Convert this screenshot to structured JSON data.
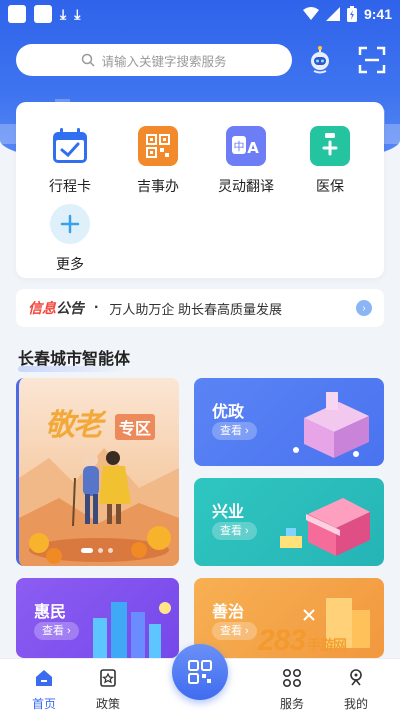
{
  "status_bar": {
    "time": "9:41"
  },
  "search": {
    "placeholder": "请输入关键字搜索服务"
  },
  "services": [
    {
      "label": "行程卡",
      "icon": "calendar-check-icon",
      "color": "#2f6ff0"
    },
    {
      "label": "吉事办",
      "icon": "qrcode-icon",
      "color": "#f28a2c"
    },
    {
      "label": "灵动翻译",
      "icon": "translate-icon",
      "color": "#6c7df5"
    },
    {
      "label": "医保",
      "icon": "medical-icon",
      "color": "#25c4a0"
    },
    {
      "label": "更多",
      "icon": "plus-icon",
      "color": "#3aa0e8"
    }
  ],
  "notice": {
    "tag_a": "信息",
    "tag_b": "公告",
    "text": "万人助万企 助长春高质量发展"
  },
  "section": {
    "title": "长春城市智能体"
  },
  "tiles": {
    "elder": {
      "title": "敬老",
      "badge": "专区"
    },
    "youzheng": {
      "title": "优政",
      "button": "查看 ›"
    },
    "xingye": {
      "title": "兴业",
      "button": "查看 ›"
    },
    "huimin": {
      "title": "惠民",
      "button": "查看 ›"
    },
    "shanzhi": {
      "title": "善治",
      "button": "查看 ›"
    }
  },
  "bottom_nav": [
    {
      "label": "首页",
      "icon": "home-icon",
      "active": true
    },
    {
      "label": "政策",
      "icon": "policy-icon",
      "active": false
    },
    {
      "label": "服务",
      "icon": "grid-icon",
      "active": false
    },
    {
      "label": "我的",
      "icon": "user-icon",
      "active": false
    }
  ],
  "watermark": {
    "text": "283",
    "sub": "手游网"
  },
  "colors": {
    "primary": "#3a6cf0"
  }
}
